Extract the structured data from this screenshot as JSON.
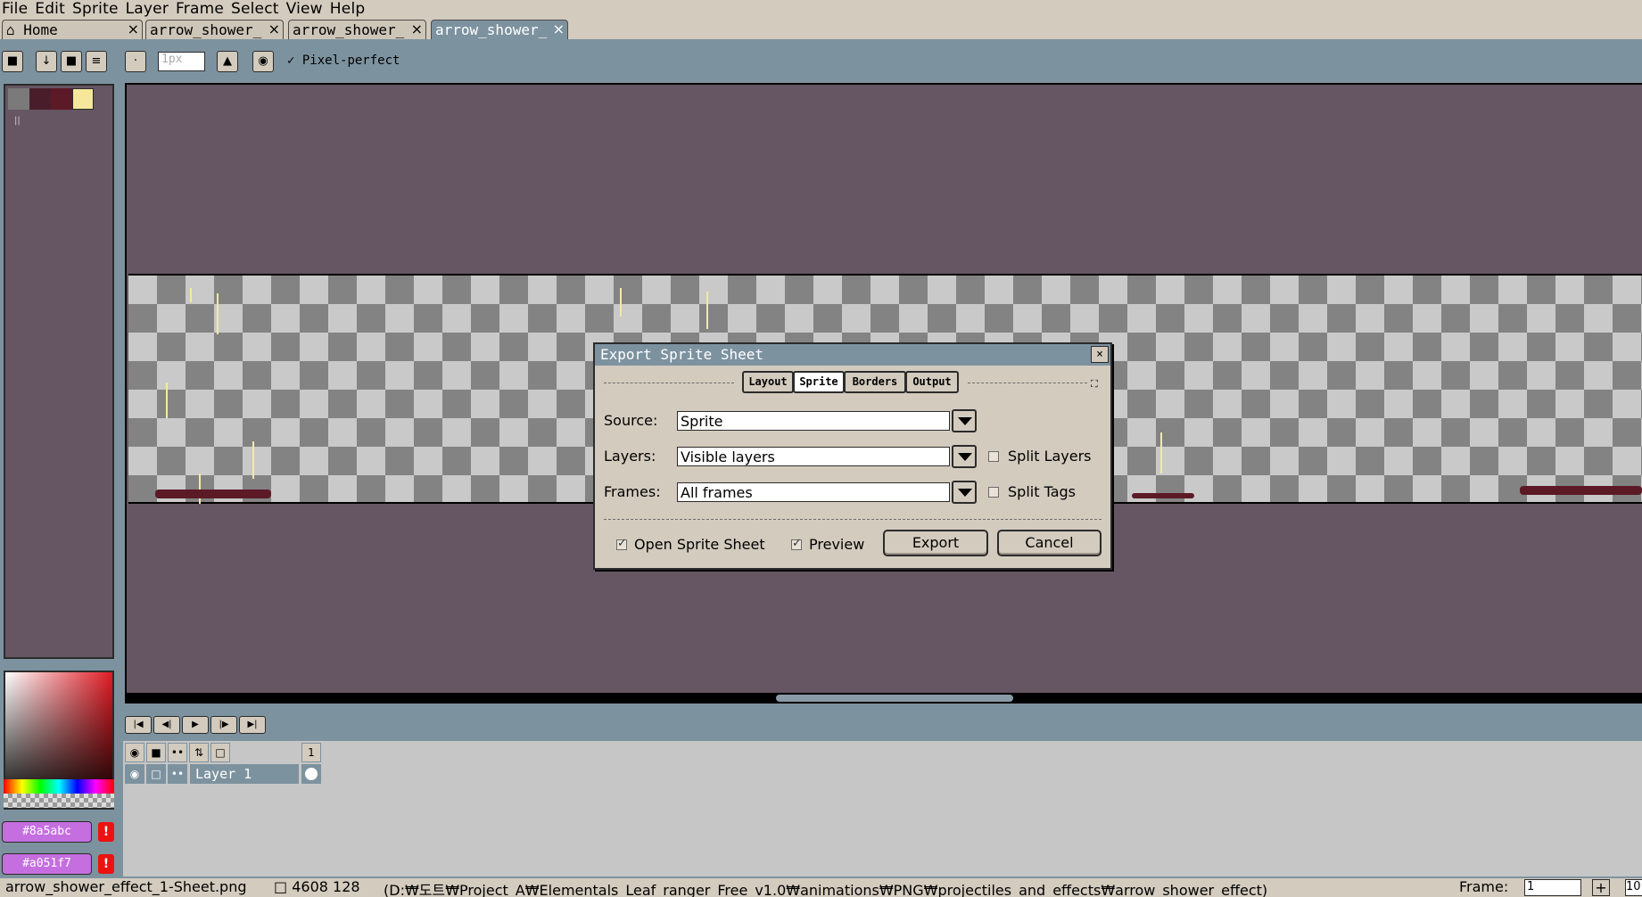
{
  "menu": [
    "File",
    "Edit",
    "Sprite",
    "Layer",
    "Frame",
    "Select",
    "View",
    "Help"
  ],
  "tabs": [
    {
      "label": "Home",
      "close": "×"
    },
    {
      "label": "arrow_shower_",
      "close": "×"
    },
    {
      "label": "arrow_shower_",
      "close": "×"
    },
    {
      "label": "arrow_shower_",
      "close": "×"
    }
  ],
  "toolbar": {
    "brush_size": "1px",
    "pixel_perfect_label": "Pixel-perfect",
    "pixel_perfect_checked": true
  },
  "palette": {
    "swatches": [
      "#7a7a7a",
      "#4a1d2b",
      "#5b1a26",
      "#f6e79b"
    ],
    "foreground_hex": "#8a5abc",
    "background_hex": "#a051f7"
  },
  "dialog": {
    "title": "Export Sprite Sheet",
    "close": "×",
    "tabs": [
      "Layout",
      "Sprite",
      "Borders",
      "Output"
    ],
    "active_tab": "Sprite",
    "source_label": "Source:",
    "source_value": "Sprite",
    "layers_label": "Layers:",
    "layers_value": "Visible layers",
    "frames_label": "Frames:",
    "frames_value": "All frames",
    "split_layers_label": "Split Layers",
    "split_layers_checked": false,
    "split_tags_label": "Split Tags",
    "split_tags_checked": false,
    "open_sprite_sheet_label": "Open Sprite Sheet",
    "open_sprite_sheet_checked": true,
    "preview_label": "Preview",
    "preview_checked": true,
    "export_label": "Export",
    "cancel_label": "Cancel"
  },
  "timeline": {
    "layer_name": "Layer 1",
    "frame_number": "1"
  },
  "status": {
    "filename": "arrow_shower_effect_1-Sheet.png",
    "size": "4608 128",
    "path": "(D:₩도트₩Project_A₩Elementals_Leaf_ranger_Free_v1.0₩animations₩PNG₩projectiles_and_effects₩arrow_shower_effect)",
    "frame_label": "Frame:",
    "frame_value": "1",
    "add": "+",
    "zoom": "10"
  }
}
